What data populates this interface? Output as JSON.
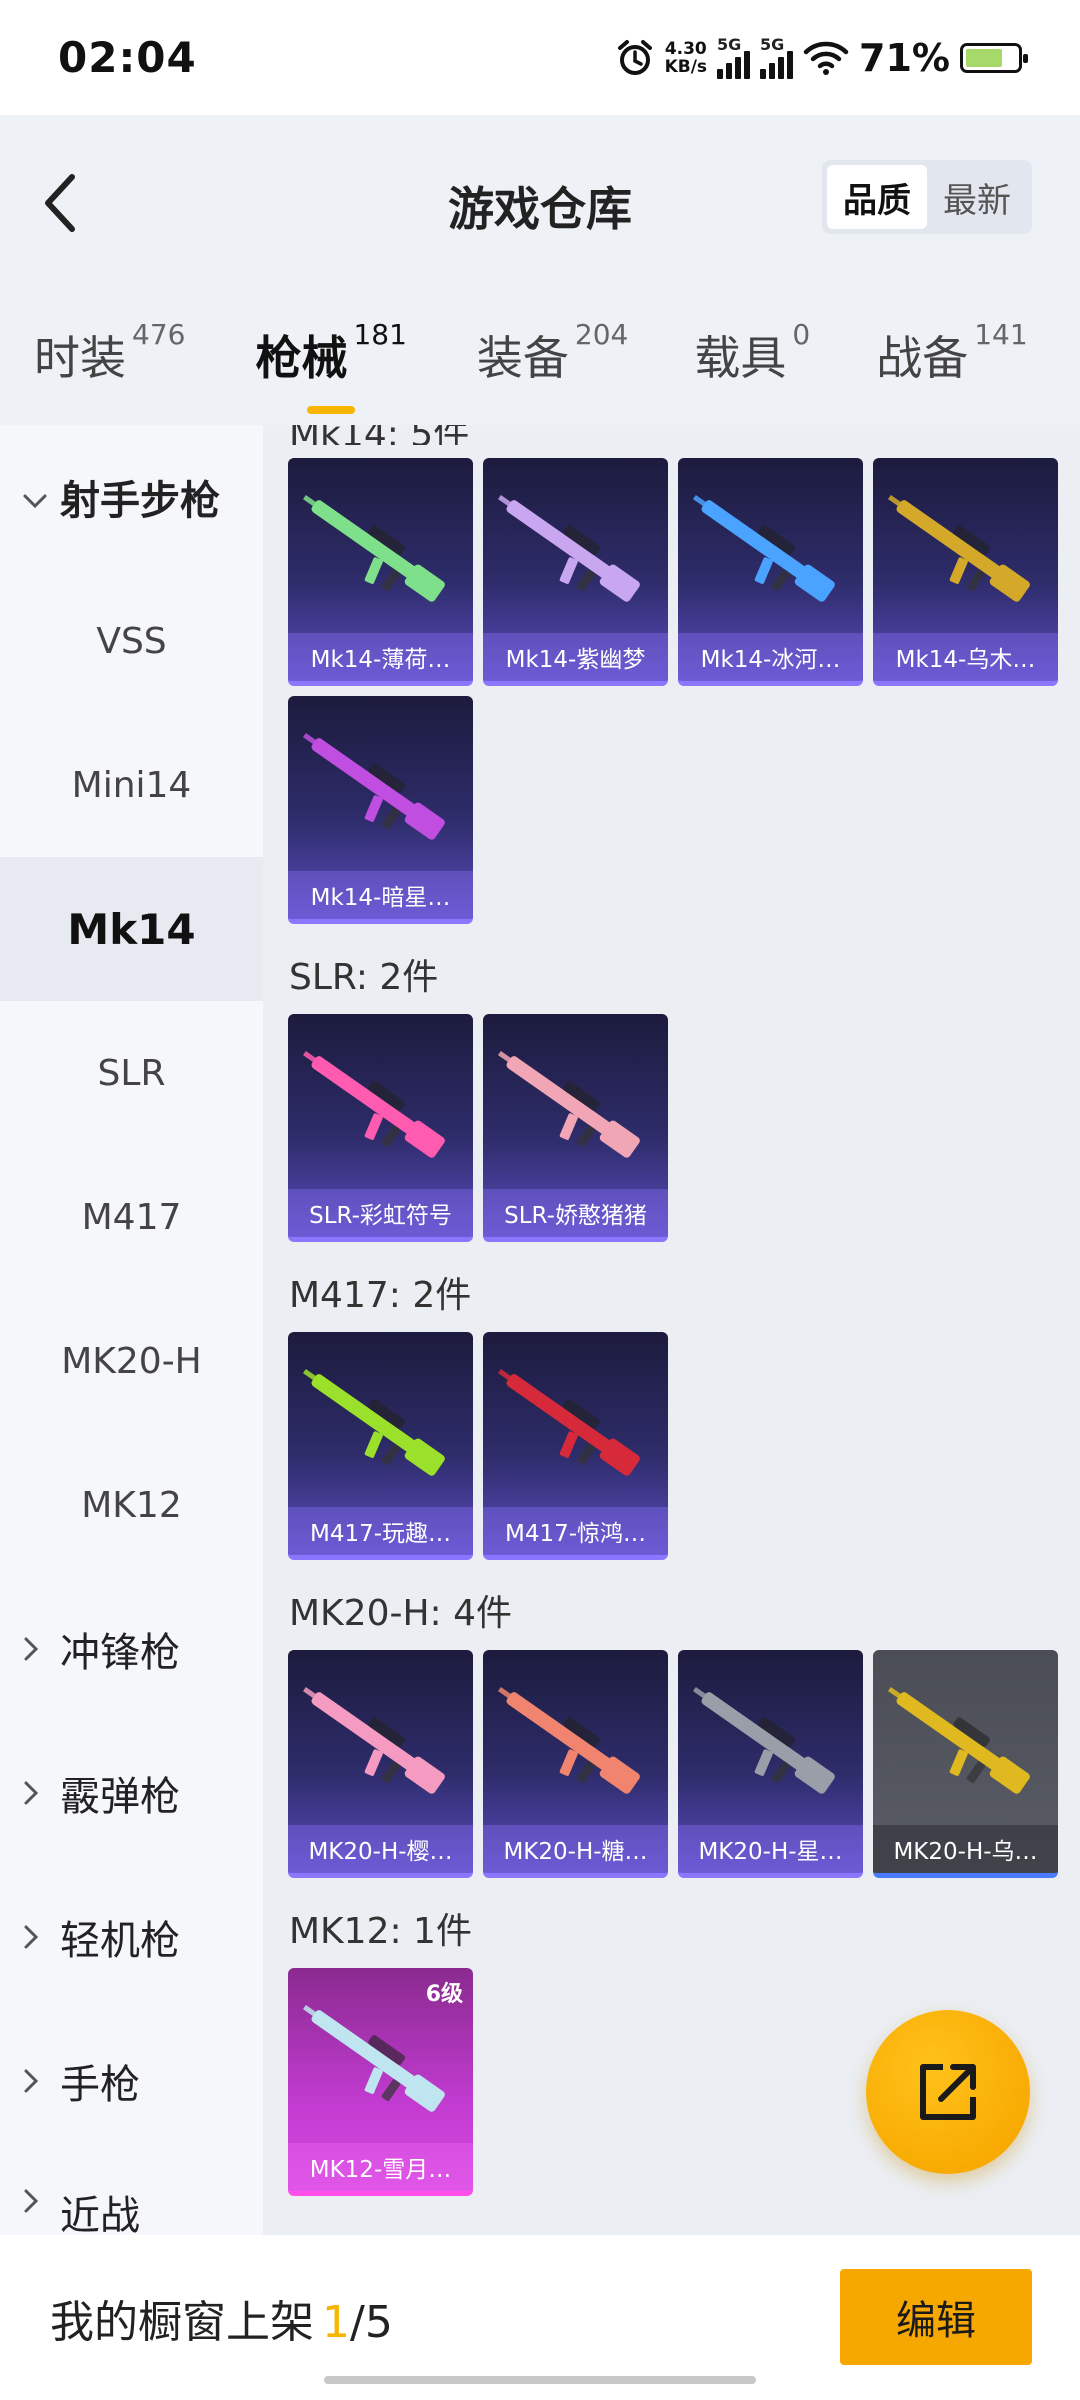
{
  "status_bar": {
    "time": "02:04",
    "net_speed_value": "4.30",
    "net_speed_unit": "KB/s",
    "sim1": "5G",
    "sim2": "5G",
    "battery": "71%"
  },
  "header": {
    "title": "游戏仓库",
    "sort_options": [
      "品质",
      "最新"
    ],
    "active_sort": "品质"
  },
  "tabs": [
    {
      "label": "时装",
      "count": "476"
    },
    {
      "label": "枪械",
      "count": "181",
      "active": true
    },
    {
      "label": "装备",
      "count": "204"
    },
    {
      "label": "载具",
      "count": "0"
    },
    {
      "label": "战备",
      "count": "141"
    }
  ],
  "sidebar": {
    "items": [
      {
        "label": "射手步枪",
        "type": "group",
        "expanded": true
      },
      {
        "label": "VSS",
        "type": "sub"
      },
      {
        "label": "Mini14",
        "type": "sub"
      },
      {
        "label": "Mk14",
        "type": "sub",
        "selected": true
      },
      {
        "label": "SLR",
        "type": "sub"
      },
      {
        "label": "M417",
        "type": "sub"
      },
      {
        "label": "MK20-H",
        "type": "sub"
      },
      {
        "label": "MK12",
        "type": "sub"
      },
      {
        "label": "冲锋枪",
        "type": "group"
      },
      {
        "label": "霰弹枪",
        "type": "group"
      },
      {
        "label": "轻机枪",
        "type": "group"
      },
      {
        "label": "手枪",
        "type": "group"
      },
      {
        "label": "近战",
        "type": "group"
      }
    ]
  },
  "sections": [
    {
      "title": "Mk14: 5件",
      "items": [
        {
          "name": "Mk14-薄荷…",
          "color": "#7ee08a"
        },
        {
          "name": "Mk14-紫幽梦",
          "color": "#c9a6f0"
        },
        {
          "name": "Mk14-冰河…",
          "color": "#4aa3ff"
        },
        {
          "name": "Mk14-乌木…",
          "color": "#d4a92a"
        },
        {
          "name": "Mk14-暗星…",
          "color": "#c04ee0"
        }
      ]
    },
    {
      "title": "SLR: 2件",
      "items": [
        {
          "name": "SLR-彩虹符号",
          "color": "#ff5bb0"
        },
        {
          "name": "SLR-娇憨猪猪",
          "color": "#f0a6b4"
        }
      ]
    },
    {
      "title": "M417: 2件",
      "items": [
        {
          "name": "M417-玩趣…",
          "color": "#9be02a"
        },
        {
          "name": "M417-惊鸿…",
          "color": "#d62a3a"
        }
      ]
    },
    {
      "title": "MK20-H: 4件",
      "items": [
        {
          "name": "MK20-H-樱…",
          "color": "#f59ac0"
        },
        {
          "name": "MK20-H-糖…",
          "color": "#f0846e"
        },
        {
          "name": "MK20-H-星…",
          "color": "#9a9ea8"
        },
        {
          "name": "MK20-H-乌…",
          "color": "#e0b820",
          "style": "gray"
        }
      ]
    },
    {
      "title": "MK12: 1件",
      "items": [
        {
          "name": "MK12-雪月…",
          "color": "#bfe6f0",
          "style": "pink",
          "level": "6级"
        }
      ]
    }
  ],
  "bottom": {
    "label": "我的橱窗上架",
    "current": "1",
    "total": "/5",
    "edit_label": "编辑"
  },
  "colors": {
    "accent": "#f7b500",
    "card_purple": "#2e2c6a",
    "card_border": "#8a76ff"
  }
}
